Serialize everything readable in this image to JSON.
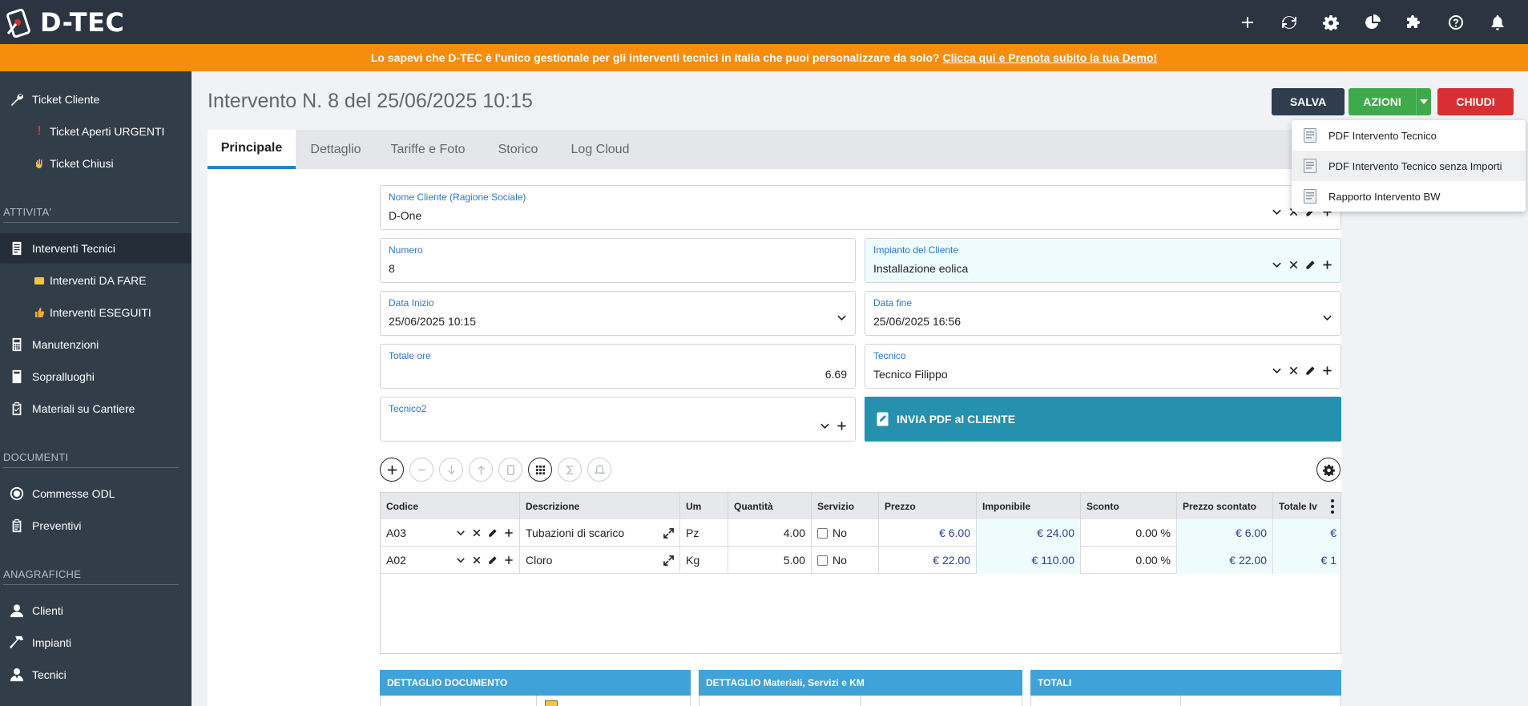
{
  "app": {
    "name": "D-TEC"
  },
  "banner": {
    "text": "Lo sapevi che D-TEC è l'unico gestionale per gli interventi tecnici in Italia che puoi personalizzare da solo?",
    "link": "Clicca qui e Prenota subito la tua Demo!"
  },
  "topbar_icons": [
    "plus-icon",
    "refresh-icon",
    "gear-icon",
    "pie-chart-icon",
    "puzzle-icon",
    "help-icon",
    "bell-icon"
  ],
  "sidebar": {
    "items": [
      {
        "label": "Ticket Cliente",
        "icon": "wrench-icon"
      },
      {
        "label": "Ticket Aperti URGENTI",
        "icon": "exclamation-icon"
      },
      {
        "label": "Ticket Chiusi",
        "icon": "hand-icon"
      },
      {
        "label": "Interventi Tecnici",
        "icon": "document-icon"
      },
      {
        "label": "Interventi DA FARE",
        "icon": "folder-icon"
      },
      {
        "label": "Interventi ESEGUITI",
        "icon": "thumbs-up-icon"
      },
      {
        "label": "Manutenzioni",
        "icon": "calculator-icon"
      },
      {
        "label": "Sopralluoghi",
        "icon": "file-icon"
      },
      {
        "label": "Materiali su Cantiere",
        "icon": "clipboard-icon"
      },
      {
        "label": "Commesse ODL",
        "icon": "circle-icon"
      },
      {
        "label": "Preventivi",
        "icon": "clipboard-list-icon"
      },
      {
        "label": "Clienti",
        "icon": "user-icon"
      },
      {
        "label": "Impianti",
        "icon": "hammer-icon"
      },
      {
        "label": "Tecnici",
        "icon": "user-tie-icon"
      }
    ],
    "sections": [
      "ATTIVITA'",
      "DOCUMENTI",
      "ANAGRAFICHE"
    ]
  },
  "page": {
    "title": "Intervento N. 8 del 25/06/2025 10:15"
  },
  "buttons": {
    "salva": "SALVA",
    "azioni": "AZIONI",
    "chiudi": "CHIUDI"
  },
  "azioni_menu": [
    "PDF Intervento Tecnico",
    "PDF Intervento Tecnico senza Importi",
    "Rapporto Intervento BW"
  ],
  "tabs": [
    "Principale",
    "Dettaglio",
    "Tariffe e Foto",
    "Storico",
    "Log Cloud"
  ],
  "form": {
    "cliente": {
      "label": "Nome Cliente (Ragione Sociale)",
      "value": "D-One"
    },
    "numero": {
      "label": "Numero",
      "value": "8"
    },
    "impianto": {
      "label": "Impianto del Cliente",
      "value": "Installazione eolica"
    },
    "data_inizio": {
      "label": "Data Inizio",
      "value": "25/06/2025 10:15"
    },
    "data_fine": {
      "label": "Data fine",
      "value": "25/06/2025 16:56"
    },
    "totale_ore": {
      "label": "Totale ore",
      "value": "6.69"
    },
    "tecnico": {
      "label": "Tecnico",
      "value": "Tecnico Filippo"
    },
    "tecnico2": {
      "label": "Tecnico2",
      "value": ""
    },
    "invia_pdf": "INVIA PDF al CLIENTE"
  },
  "grid": {
    "headers": [
      "Codice",
      "Descrizione",
      "Um",
      "Quantità",
      "Servizio",
      "Prezzo",
      "Imponibile",
      "Sconto",
      "Prezzo scontato",
      "Totale Iv"
    ],
    "rows": [
      {
        "codice": "A03",
        "descrizione": "Tubazioni di scarico",
        "um": "Pz",
        "quantita": "4.00",
        "servizio": "No",
        "prezzo": "€ 6.00",
        "imponibile": "€ 24.00",
        "sconto": "0.00 %",
        "prezzo_scontato": "€ 6.00",
        "totale": "€"
      },
      {
        "codice": "A02",
        "descrizione": "Cloro",
        "um": "Kg",
        "quantita": "5.00",
        "servizio": "No",
        "prezzo": "€ 22.00",
        "imponibile": "€ 110.00",
        "sconto": "0.00 %",
        "prezzo_scontato": "€ 22.00",
        "totale": "€ 1"
      }
    ]
  },
  "panels": [
    "DETTAGLIO DOCUMENTO",
    "DETTAGLIO Materiali, Servizi e KM",
    "TOTALI"
  ],
  "colors": {
    "topbar": "#2b3440",
    "banner": "#f78d0b",
    "sidebar": "#323d4a",
    "salva": "#2f3d4e",
    "azioni": "#3eaa4b",
    "chiudi": "#d72f33",
    "invia": "#2591af",
    "panel": "#3fa2d8",
    "tab_accent": "#1f86c2"
  }
}
